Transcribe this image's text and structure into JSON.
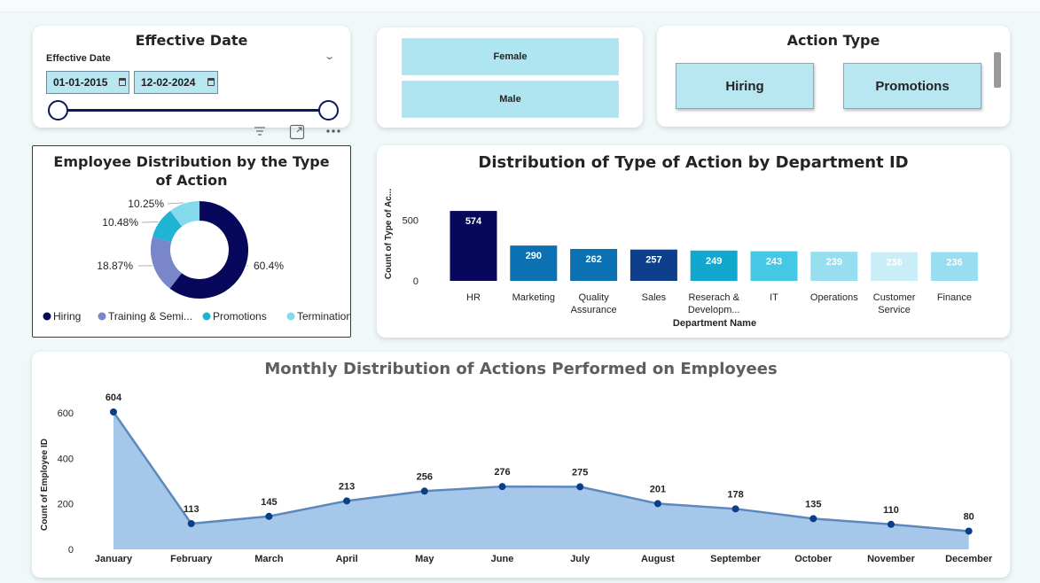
{
  "colors": {
    "hiring": "#07085c",
    "training": "#7986c9",
    "promotions": "#1fb3d4",
    "termination": "#85d9ec",
    "area_fill": "#a5c8ea",
    "line": "#5e87bb",
    "point": "#0a3f88"
  },
  "date_slicer": {
    "title": "Effective Date",
    "field_label": "Effective Date",
    "start": "01-01-2015",
    "end": "12-02-2024",
    "chevron_icon": "chevron-down-icon",
    "calendar_icon": "calendar-icon"
  },
  "toolbar_icons": [
    "filter-icon",
    "focus-mode-icon",
    "more-options-icon"
  ],
  "gender_slicer": {
    "options": [
      "Female",
      "Male"
    ]
  },
  "action_slicer": {
    "title": "Action Type",
    "options": [
      "Hiring",
      "Promotions"
    ]
  },
  "donut": {
    "title": "Employee Distribution by the Type of Action",
    "legend": [
      "Hiring",
      "Training & Semi...",
      "Promotions",
      "Termination"
    ]
  },
  "bar_card": {
    "title": "Distribution of Type of Action by Department ID"
  },
  "line_card": {
    "title": "Monthly Distribution of Actions Performed on Employees"
  },
  "chart_data": [
    {
      "type": "pie",
      "title": "Employee Distribution by the Type of Action",
      "categories": [
        "Hiring",
        "Training & Semi...",
        "Promotions",
        "Termination"
      ],
      "values": [
        60.4,
        18.87,
        10.48,
        10.25
      ],
      "labels": [
        "60.4%",
        "18.87%",
        "10.48%",
        "10.25%"
      ],
      "legend_position": "bottom"
    },
    {
      "type": "bar",
      "title": "Distribution of Type of Action by Department ID",
      "categories": [
        "HR",
        "Marketing",
        "Quality Assurance",
        "Sales",
        "Reserach & Developm...",
        "IT",
        "Operations",
        "Customer Service",
        "Finance"
      ],
      "values": [
        574,
        290,
        262,
        257,
        249,
        243,
        239,
        236,
        236
      ],
      "xlabel": "Department Name",
      "ylabel": "Count of Type of Ac...",
      "yticks": [
        0,
        500
      ],
      "ylim": [
        0,
        640
      ]
    },
    {
      "type": "area",
      "title": "Monthly Distribution of Actions Performed on Employees",
      "categories": [
        "January",
        "February",
        "March",
        "April",
        "May",
        "June",
        "July",
        "August",
        "September",
        "October",
        "November",
        "December"
      ],
      "values": [
        604,
        113,
        145,
        213,
        256,
        276,
        275,
        201,
        178,
        135,
        110,
        80
      ],
      "ylabel": "Count of Employee ID",
      "yticks": [
        0,
        200,
        400,
        600
      ],
      "ylim": [
        0,
        620
      ]
    }
  ]
}
